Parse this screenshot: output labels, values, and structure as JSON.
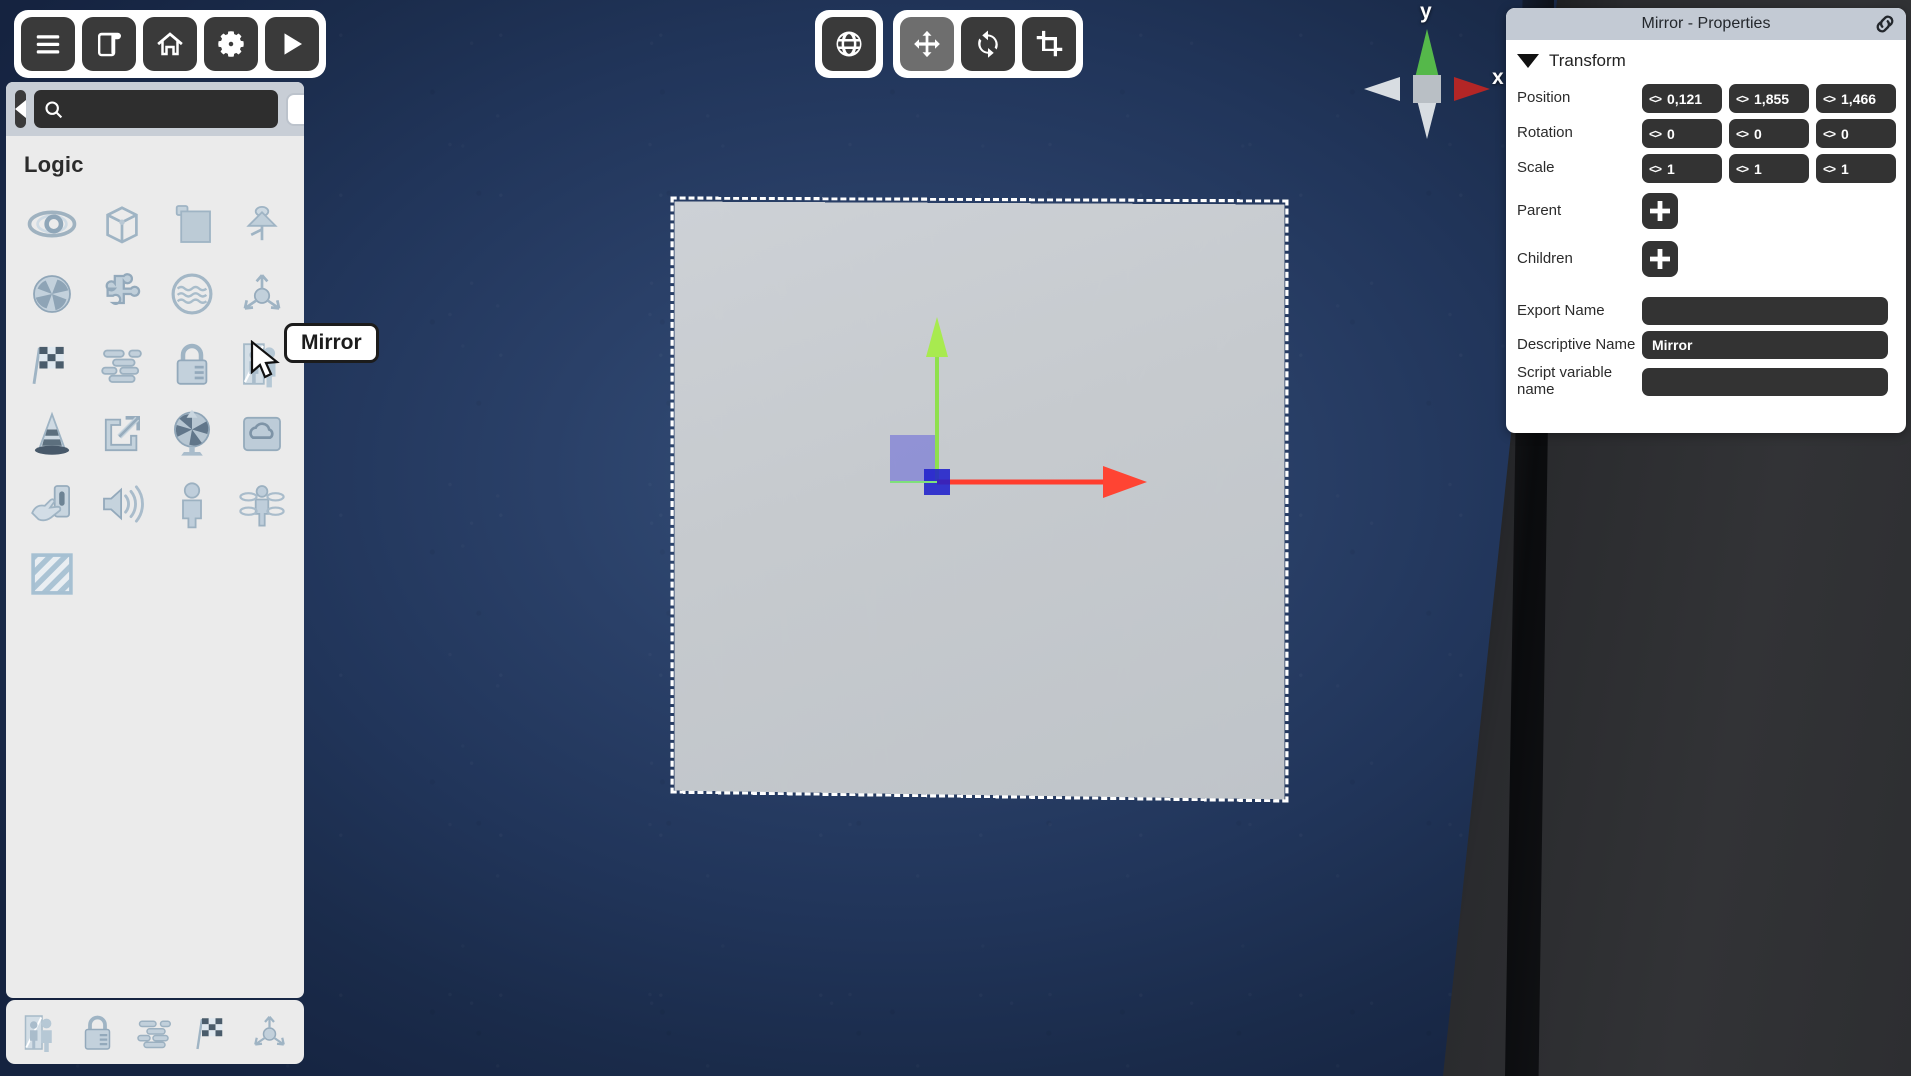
{
  "app": {
    "viewport_background": "#2a4068",
    "accent_axis_x": "#cc2222",
    "accent_axis_y": "#6fcc4a",
    "accent_axis_z": "#3a3ad0"
  },
  "main_toolbar": {
    "buttons": [
      {
        "name": "menu-button",
        "icon": "hamburger-icon",
        "label": "Menu",
        "active": false
      },
      {
        "name": "scene-button",
        "icon": "scroll-icon",
        "label": "Scene",
        "active": false
      },
      {
        "name": "home-button",
        "icon": "home-icon",
        "label": "Home",
        "active": false
      },
      {
        "name": "settings-button",
        "icon": "gear-icon",
        "label": "Settings",
        "active": false
      },
      {
        "name": "play-button",
        "icon": "play-icon",
        "label": "Play",
        "active": false
      }
    ]
  },
  "space_toolbar": {
    "buttons": [
      {
        "name": "world-space-toggle",
        "icon": "globe-icon",
        "label": "World Space",
        "active": false
      }
    ]
  },
  "transform_toolbar": {
    "buttons": [
      {
        "name": "move-tool",
        "icon": "move-icon",
        "label": "Move",
        "active": true
      },
      {
        "name": "rotate-tool",
        "icon": "rotate-icon",
        "label": "Rotate",
        "active": false
      },
      {
        "name": "scale-tool",
        "icon": "crop-icon",
        "label": "Scale",
        "active": false
      }
    ]
  },
  "asset_panel": {
    "search": {
      "value": "",
      "placeholder": ""
    },
    "collapse_label": "Collapse panel",
    "filters": [
      {
        "name": "filter-toggle-1",
        "on": false
      },
      {
        "name": "filter-toggle-2",
        "on": true
      },
      {
        "name": "filter-toggle-3",
        "on": false
      }
    ],
    "category": "Logic",
    "items": [
      {
        "label": "Visibility",
        "icon": "eye-icon"
      },
      {
        "label": "Bounding Box",
        "icon": "wireframe-cube-icon"
      },
      {
        "label": "Panel",
        "icon": "panel-icon"
      },
      {
        "label": "Lamp",
        "icon": "lamp-icon"
      },
      {
        "label": "Camera",
        "icon": "aperture-icon"
      },
      {
        "label": "Plugin",
        "icon": "puzzle-icon"
      },
      {
        "label": "Water",
        "icon": "water-circle-icon"
      },
      {
        "label": "Axis",
        "icon": "axis-arrows-icon"
      },
      {
        "label": "Goal",
        "icon": "checkered-flag-icon"
      },
      {
        "label": "Motion",
        "icon": "motion-lines-icon"
      },
      {
        "label": "Lock",
        "icon": "padlock-icon"
      },
      {
        "label": "Mirror",
        "icon": "mirror-person-icon"
      },
      {
        "label": "Cone",
        "icon": "traffic-cone-icon"
      },
      {
        "label": "External Link",
        "icon": "external-link-icon"
      },
      {
        "label": "Fan",
        "icon": "fan-icon"
      },
      {
        "label": "Weather",
        "icon": "cloud-panel-icon"
      },
      {
        "label": "Button Press",
        "icon": "hand-switch-icon"
      },
      {
        "label": "Sound",
        "icon": "speaker-icon"
      },
      {
        "label": "Character",
        "icon": "person-icon"
      },
      {
        "label": "Particles",
        "icon": "person-particles-icon"
      },
      {
        "label": "Hatch Plane",
        "icon": "hatched-square-icon"
      }
    ]
  },
  "favourites_bar": {
    "items": [
      {
        "label": "Mirror",
        "icon": "mirror-person-icon"
      },
      {
        "label": "Lock",
        "icon": "padlock-icon"
      },
      {
        "label": "Motion",
        "icon": "motion-lines-icon"
      },
      {
        "label": "Goal",
        "icon": "checkered-flag-icon"
      },
      {
        "label": "Axis",
        "icon": "axis-arrows-icon"
      }
    ]
  },
  "tooltip": {
    "text": "Mirror"
  },
  "axis_gizmo": {
    "x_label": "x",
    "y_label": "y",
    "x_color": "#b32626",
    "y_color": "#55b84a",
    "neg_color": "#d8dde2"
  },
  "properties": {
    "title": "Mirror - Properties",
    "link_icon": "link-icon",
    "section": {
      "label": "Transform",
      "expanded": true
    },
    "rows": [
      {
        "label": "Position",
        "type": "vector",
        "values": [
          "0,121",
          "1,855",
          "1,466"
        ]
      },
      {
        "label": "Rotation",
        "type": "vector",
        "values": [
          "0",
          "0",
          "0"
        ]
      },
      {
        "label": "Scale",
        "type": "vector",
        "values": [
          "1",
          "1",
          "1"
        ]
      },
      {
        "label": "Parent",
        "type": "add"
      },
      {
        "label": "Children",
        "type": "add"
      },
      {
        "label": "Export Name",
        "type": "text",
        "value": ""
      },
      {
        "label": "Descriptive Name",
        "type": "text",
        "value": "Mirror"
      },
      {
        "label": "Script variable name",
        "type": "text",
        "value": ""
      }
    ]
  }
}
